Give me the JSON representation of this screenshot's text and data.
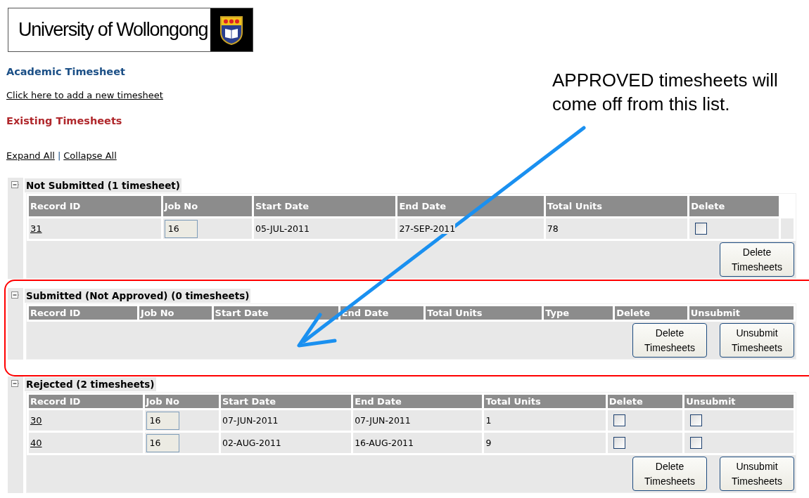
{
  "logo": {
    "text": "University of Wollongong"
  },
  "title": "Academic Timesheet",
  "add_link": "Click here to add a new timesheet",
  "subtitle": "Existing Timesheets",
  "expand_all": "Expand All",
  "separator": "|",
  "collapse_all": "Collapse All",
  "sections": [
    {
      "title": "Not Submitted (1 timesheet)",
      "expanded": true,
      "columns": [
        "Record ID",
        "Job No",
        "Start Date",
        "End Date",
        "Total Units",
        "Delete"
      ],
      "rows": [
        {
          "record_id": "31",
          "job_no": "16",
          "start_date": "05-JUL-2011",
          "end_date": "27-SEP-2011",
          "total_units": "78",
          "delete": false
        }
      ],
      "buttons": [
        "Delete Timesheets"
      ]
    },
    {
      "title": "Submitted (Not Approved) (0 timesheets)",
      "expanded": true,
      "columns": [
        "Record ID",
        "Job No",
        "Start Date",
        "End Date",
        "Total Units",
        "Type",
        "Delete",
        "Unsubmit"
      ],
      "buttons": [
        "Delete Timesheets",
        "Unsubmit Timesheets"
      ]
    },
    {
      "title": "Rejected (2 timesheets)",
      "expanded": true,
      "columns": [
        "Record ID",
        "Job No",
        "Start Date",
        "End Date",
        "Total Units",
        "Delete",
        "Unsubmit"
      ],
      "rows": [
        {
          "record_id": "30",
          "job_no": "16",
          "start_date": "07-JUN-2011",
          "end_date": "07-JUN-2011",
          "total_units": "1",
          "delete": false,
          "unsubmit": false
        },
        {
          "record_id": "40",
          "job_no": "16",
          "start_date": "02-AUG-2011",
          "end_date": "16-AUG-2011",
          "total_units": "9",
          "delete": false,
          "unsubmit": false
        }
      ],
      "buttons": [
        "Delete Timesheets",
        "Unsubmit Timesheets"
      ]
    }
  ],
  "annotation": {
    "text": "APPROVED timesheets will come off from this list."
  }
}
